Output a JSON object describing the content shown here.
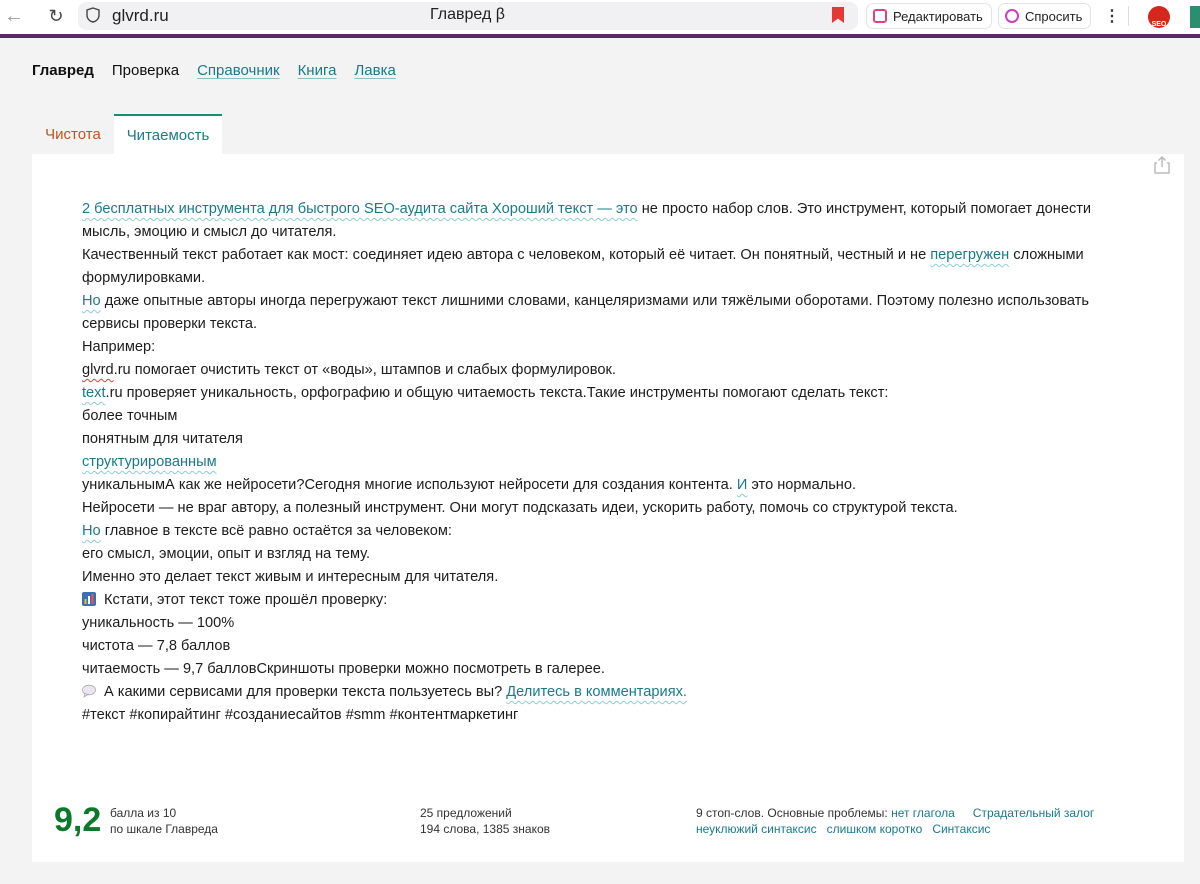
{
  "browser": {
    "url": "glvrd.ru",
    "title": "Главред β",
    "edit_label": "Редактировать",
    "ask_label": "Спросить",
    "seo_ext_label": "SEO"
  },
  "nav": {
    "brand": "Главред",
    "check": "Проверка",
    "links": [
      "Справочник",
      "Книга",
      "Лавка"
    ]
  },
  "tabs": {
    "clean": "Чистота",
    "read": "Читаемость"
  },
  "text": {
    "l1_hl": "2 бесплатных инструмента для быстрого SEO-аудита сайта Хороший текст — это",
    "l1_rest": " не просто набор слов. Это инструмент, который помогает донести мысль, эмоцию и смысл до читателя.",
    "l2_a": "Качественный текст работает как мост: соединяет идею автора с человеком, который её читает. Он понятный, честный и не ",
    "l2_hl": "перегружен",
    "l2_b": " сложными формулировками.",
    "l3_hl": "Но",
    "l3_rest": " даже опытные авторы иногда перегружают текст лишними словами, канцеляризмами или тяжёлыми оборотами. Поэтому полезно использовать сервисы проверки текста.",
    "l4": "Например:",
    "l5_err": "glvrd",
    "l5_rest": ".ru помогает очистить текст от «воды», штампов и слабых формулировок.",
    "l6_hl": "text",
    "l6_rest": ".ru проверяет уникальность, орфографию и общую читаемость текста.Такие инструменты помогают сделать текст:",
    "l7": "более точным",
    "l8": "понятным для читателя",
    "l9_hl": "структурированным",
    "l10_a": "уникальнымА как же нейросети?Сегодня многие используют нейросети для создания контента. ",
    "l10_hl": "И",
    "l10_b": " это нормально.",
    "l11": "Нейросети — не враг автору, а полезный инструмент. Они могут подсказать идеи, ускорить работу, помочь со структурой текста.",
    "l12_hl": "Но",
    "l12_rest": " главное в тексте всё равно остаётся за человеком:",
    "l13": "его смысл, эмоции, опыт и взгляд на тему.",
    "l14": "Именно это делает текст живым и интересным для читателя.",
    "l15": "Кстати, этот текст тоже прошёл проверку:",
    "l16": "уникальность — 100%",
    "l17": "чистота — 7,8 баллов",
    "l18": "читаемость — 9,7 балловСкриншоты проверки можно посмотреть в галерее.",
    "l19_a": "А какими сервисами для проверки текста пользуетесь вы? ",
    "l19_hl": "Делитесь в комментариях.",
    "l20": "#текст #копирайтинг #созданиесайтов #smm #контентмаркетинг"
  },
  "footer": {
    "score": "9,2",
    "score_line1": "балла из 10",
    "score_line2": "по шкале Главреда",
    "sentences": "25 предложений",
    "words": "194 слова, 1385 знаков",
    "stop_prefix": "9 стоп-слов. Основные проблемы: ",
    "problems_row1": [
      "нет глагола",
      "Страдательный залог"
    ],
    "problems_row2": [
      "неуклюжий синтаксис",
      "слишком коротко",
      "Синтаксис"
    ]
  }
}
